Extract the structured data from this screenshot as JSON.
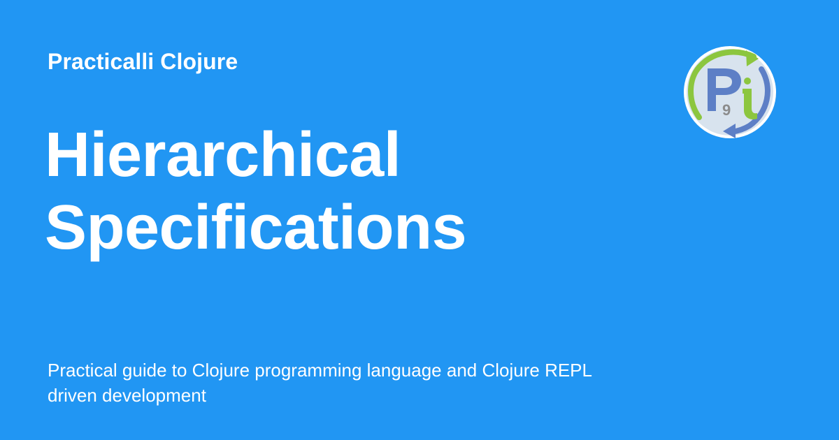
{
  "site": {
    "name": "Practicalli Clojure"
  },
  "page": {
    "title_line_1": "Hierarchical",
    "title_line_2": "Specifications",
    "description": "Practical guide to Clojure programming language and Clojure REPL driven development"
  },
  "colors": {
    "background": "#2196f3",
    "text": "#ffffff",
    "logo_circle": "#d8e3ee",
    "logo_ring": "#ffffff",
    "logo_green": "#8cc63f",
    "logo_blue": "#5d7fc6"
  },
  "logo": {
    "icon": "practicalli-logo-icon"
  }
}
